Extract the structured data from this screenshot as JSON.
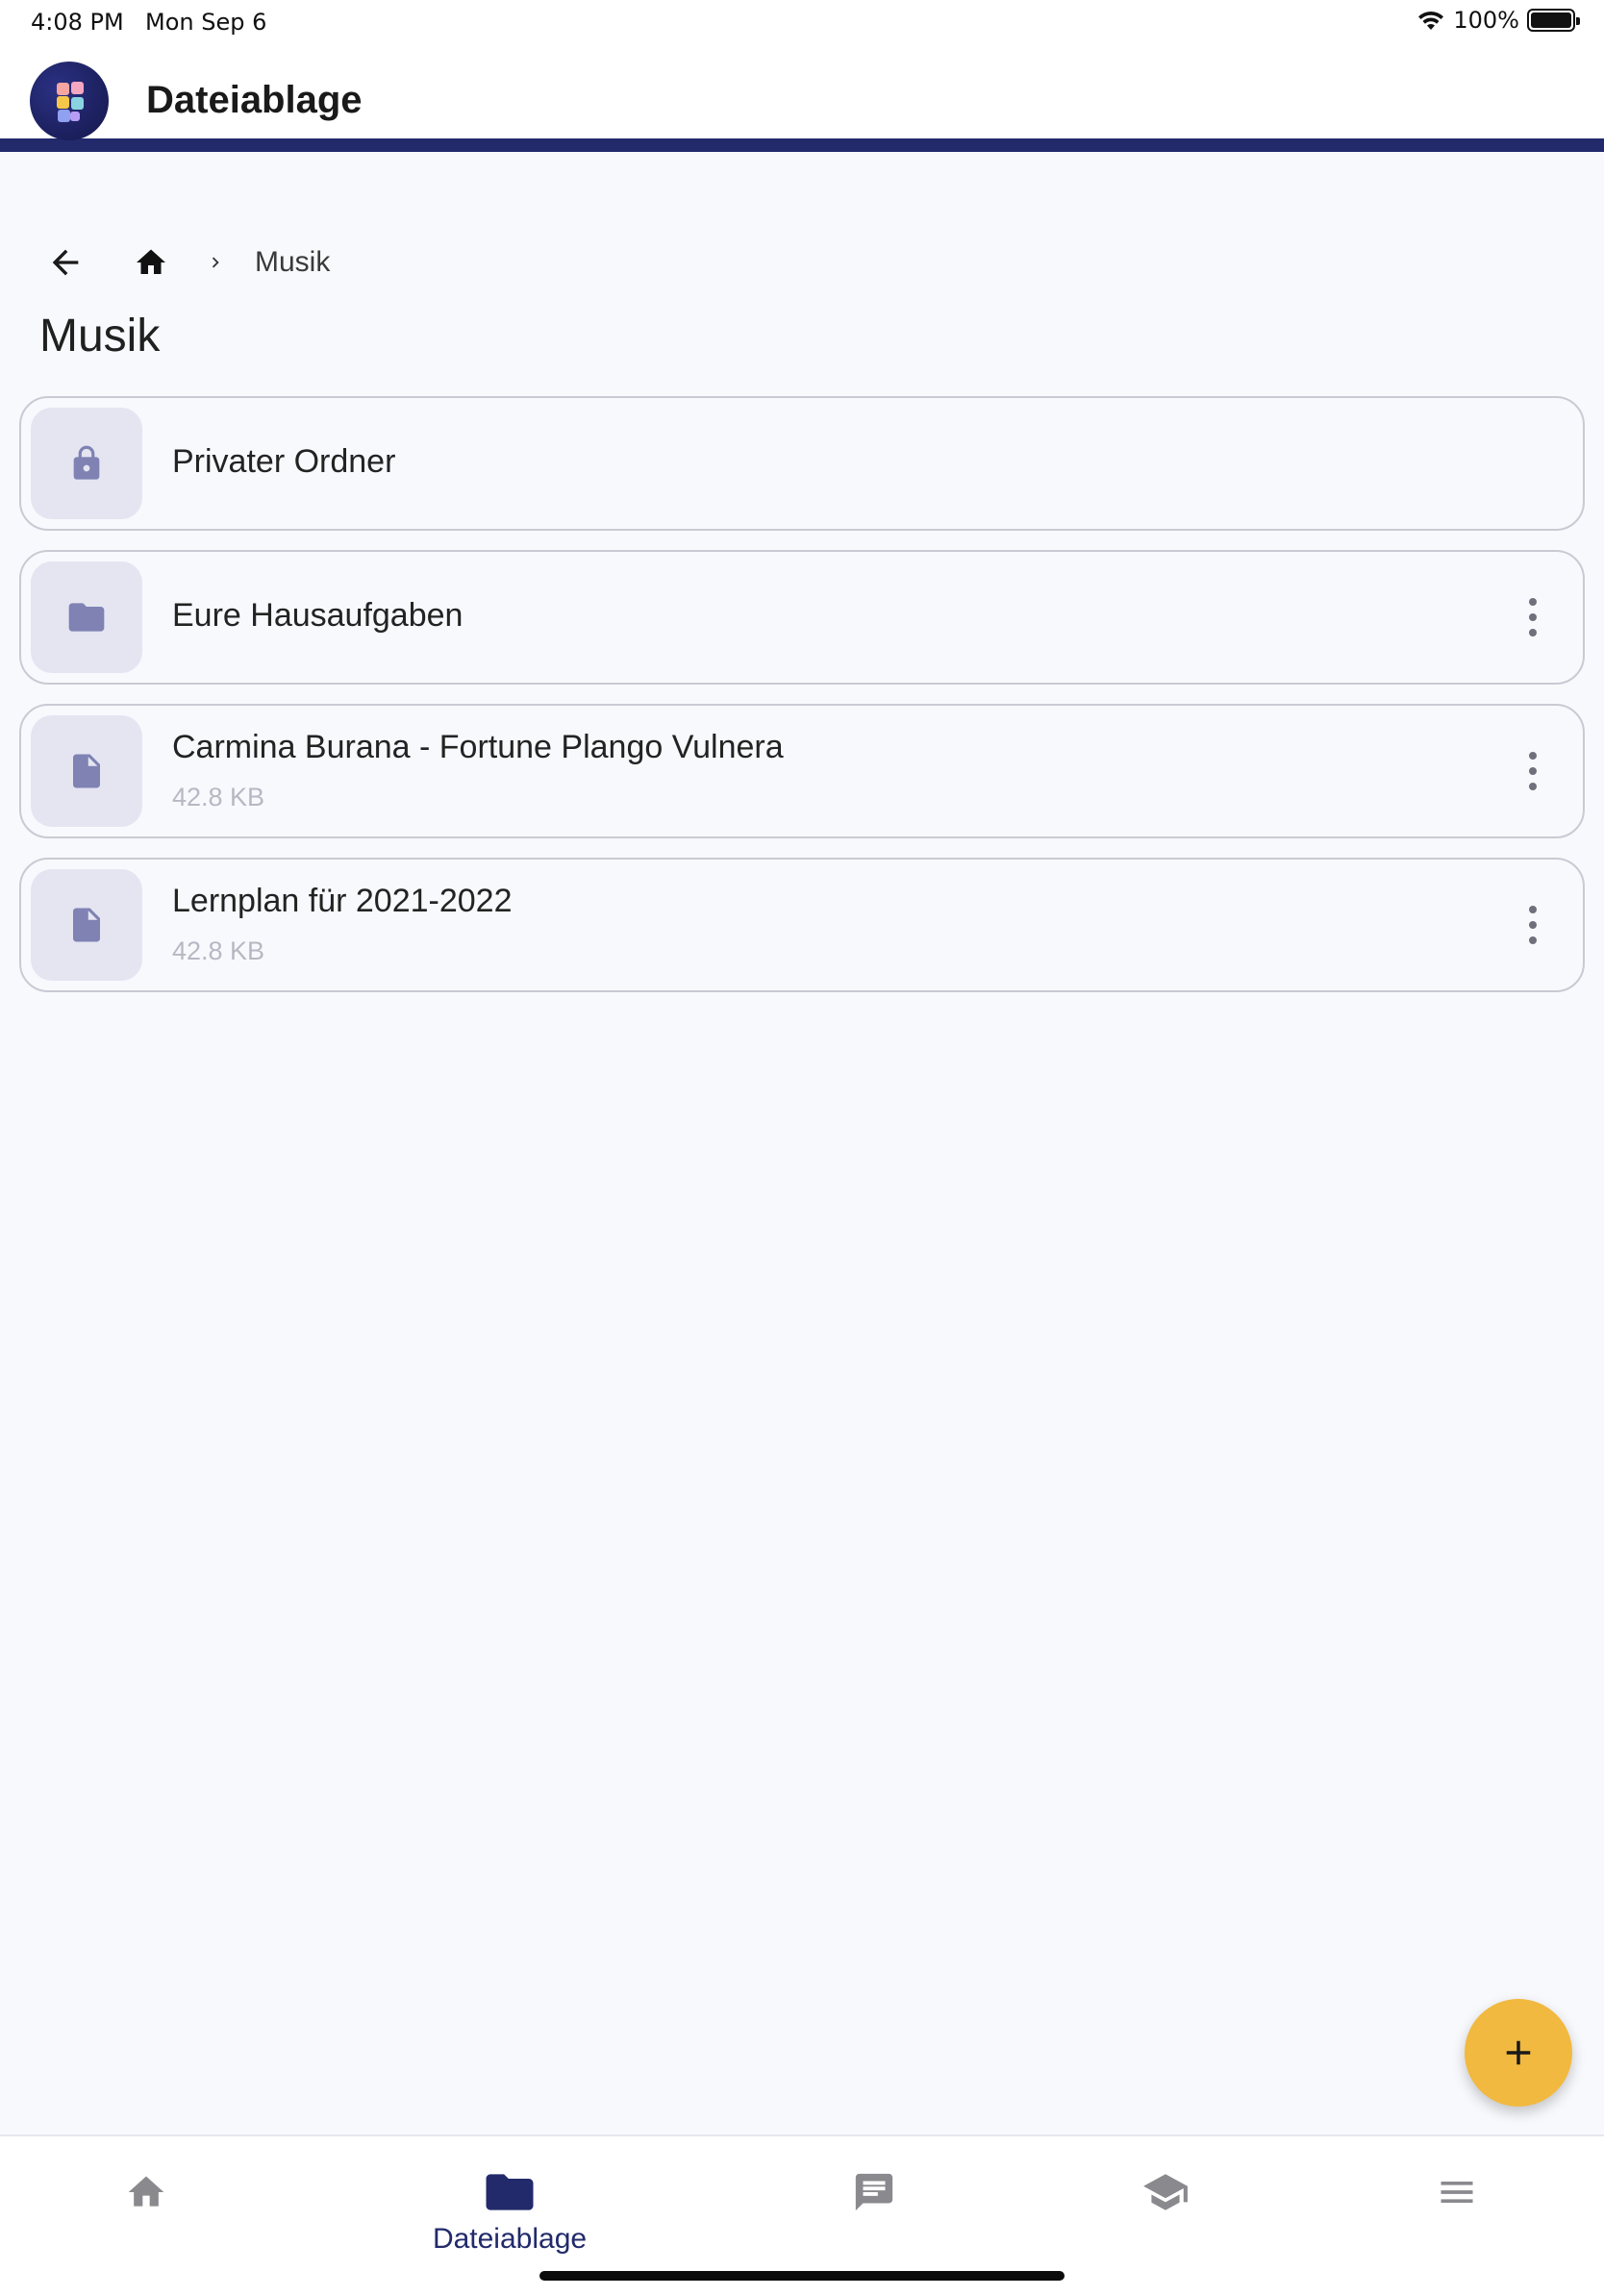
{
  "status_bar": {
    "time": "4:08 PM",
    "date": "Mon Sep 6",
    "battery": "100%"
  },
  "app_bar": {
    "title": "Dateiablage"
  },
  "breadcrumb": {
    "current": "Musik"
  },
  "page": {
    "title": "Musik"
  },
  "items": [
    {
      "name": "Privater Ordner",
      "type": "locked-folder",
      "icon": "lock-icon",
      "size": ""
    },
    {
      "name": "Eure Hausaufgaben",
      "type": "folder",
      "icon": "folder-icon",
      "size": ""
    },
    {
      "name": "Carmina Burana - Fortune Plango Vulnera",
      "type": "file",
      "icon": "file-icon",
      "size": "42.8 KB"
    },
    {
      "name": "Lernplan für 2021-2022",
      "type": "file",
      "icon": "file-icon",
      "size": "42.8 KB"
    }
  ],
  "bottom_nav": {
    "items": [
      {
        "id": "home",
        "icon": "home-icon",
        "label": "",
        "active": false
      },
      {
        "id": "files",
        "icon": "folder-icon",
        "label": "Dateiablage",
        "active": true
      },
      {
        "id": "messages",
        "icon": "chat-icon",
        "label": "",
        "active": false
      },
      {
        "id": "courses",
        "icon": "graduation-cap-icon",
        "label": "",
        "active": false
      },
      {
        "id": "menu",
        "icon": "hamburger-menu-icon",
        "label": "",
        "active": false
      }
    ]
  },
  "colors": {
    "brand": "#222a6b",
    "accent": "#f1b93f",
    "icon_muted": "#7f82b3",
    "background": "#f8f9fd"
  }
}
